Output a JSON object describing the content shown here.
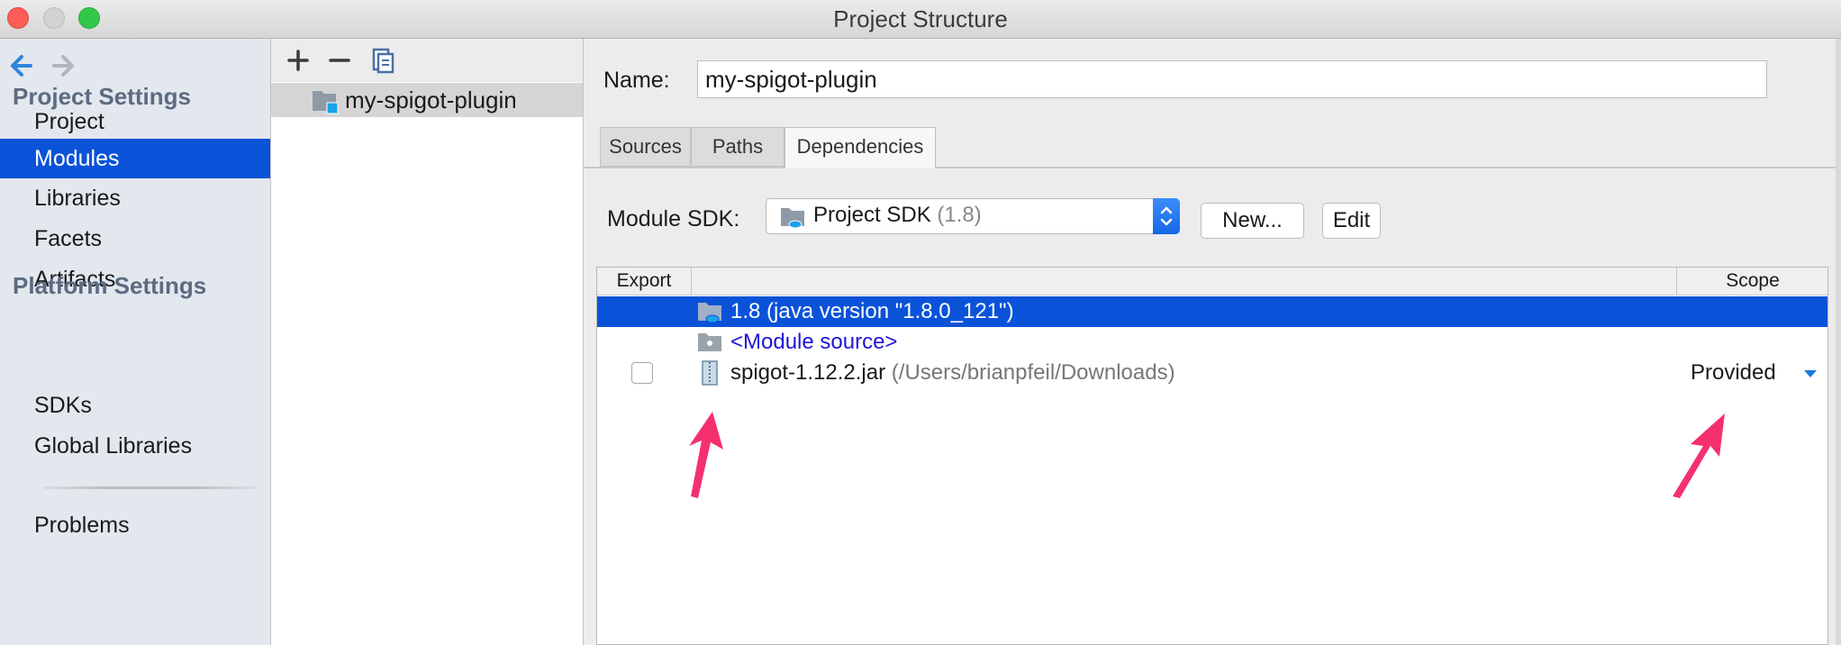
{
  "window": {
    "title": "Project Structure"
  },
  "sidebar": {
    "project_settings_header": "Project Settings",
    "project_settings_items": [
      {
        "label": "Project",
        "selected": false
      },
      {
        "label": "Modules",
        "selected": true
      },
      {
        "label": "Libraries",
        "selected": false
      },
      {
        "label": "Facets",
        "selected": false
      },
      {
        "label": "Artifacts",
        "selected": false
      }
    ],
    "platform_settings_header": "Platform Settings",
    "platform_settings_items": [
      {
        "label": "SDKs"
      },
      {
        "label": "Global Libraries"
      }
    ],
    "problems_label": "Problems"
  },
  "module_list": {
    "toolbar": {
      "add_icon": "plus-icon",
      "remove_icon": "minus-icon",
      "copy_icon": "copy-icon"
    },
    "modules": [
      {
        "label": "my-spigot-plugin",
        "selected": true
      }
    ]
  },
  "module_settings": {
    "name_label": "Name:",
    "name_value": "my-spigot-plugin",
    "tabs": [
      {
        "label": "Sources",
        "active": false
      },
      {
        "label": "Paths",
        "active": false
      },
      {
        "label": "Dependencies",
        "active": true
      }
    ],
    "sdk_label": "Module SDK:",
    "sdk_name": "Project SDK",
    "sdk_version": "(1.8)",
    "new_button": "New...",
    "edit_button": "Edit"
  },
  "dependencies_table": {
    "headers": {
      "export": "Export",
      "scope": "Scope"
    },
    "rows": [
      {
        "icon": "jdk-folder-icon",
        "name": "1.8 (java version \"1.8.0_121\")",
        "selected": true
      },
      {
        "icon": "folder-icon",
        "name": "<Module source>"
      },
      {
        "icon": "jar-icon",
        "name": "spigot-1.12.2.jar",
        "path": "(/Users/brianpfeil/Downloads)",
        "export_checked": false,
        "scope": "Provided"
      }
    ]
  },
  "colors": {
    "selection": "#0a53d9",
    "sidebar_bg": "#e3e7ee",
    "section_header": "#5c6b80",
    "module_source_link": "#1f14d6",
    "annotation_arrow": "#f5306e"
  }
}
